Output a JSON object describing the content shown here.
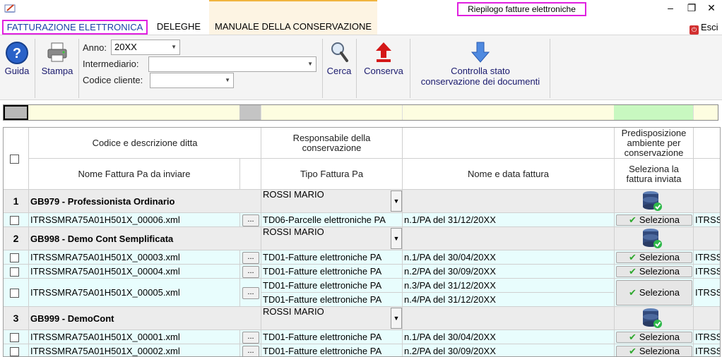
{
  "window": {
    "title": "Riepilogo fatture elettroniche",
    "minimize": "–",
    "restore": "❐",
    "close": "✕"
  },
  "tabs": [
    {
      "label": "FATTURAZIONE ELETTRONICA"
    },
    {
      "label": "DELEGHE"
    },
    {
      "label": "MANUALE DELLA CONSERVAZIONE"
    }
  ],
  "exit_label": "Esci",
  "ribbon": {
    "guida": "Guida",
    "stampa": "Stampa",
    "anno_label": "Anno:",
    "anno_value": "20XX",
    "intermediario_label": "Intermediario:",
    "intermediario_value": "",
    "codice_cliente_label": "Codice cliente:",
    "codice_cliente_value": "",
    "cerca": "Cerca",
    "conserva": "Conserva",
    "controlla_line1": "Controlla stato",
    "controlla_line2": "conservazione dei documenti"
  },
  "colors": {
    "legend_yellow": "#fdfde0",
    "legend_green": "#c8f8c0",
    "legend_gray": "#b8b8b8",
    "row_cyan": "#e8fdfd",
    "group_gray": "#ececec"
  },
  "headers": {
    "codice": "Codice e descrizione ditta",
    "responsabile": "Responsabile della conservazione",
    "predisposizione": "Predisposizione ambiente per conservazione",
    "nome_fattura": "Nome Fattura Pa da inviare",
    "tipo": "Tipo Fattura Pa",
    "nome_data": "Nome e data fattura",
    "seleziona": "Seleziona la fattura inviata"
  },
  "select_label": "Seleziona",
  "dots_label": "...",
  "groups": [
    {
      "num": "1",
      "name": "GB979 - Professionista Ordinario",
      "responsabile": "ROSSI MARIO",
      "rows": [
        {
          "file": "ITRSSMRA75A01H501X_00006.xml",
          "tipi": [
            "TD06-Parcelle elettroniche PA"
          ],
          "fatture": [
            "n.1/PA del 31/12/20XX"
          ],
          "extra": "ITRSS"
        }
      ]
    },
    {
      "num": "2",
      "name": "GB998 - Demo Cont Semplificata",
      "responsabile": "ROSSI MARIO",
      "rows": [
        {
          "file": "ITRSSMRA75A01H501X_00003.xml",
          "tipi": [
            "TD01-Fatture elettroniche PA"
          ],
          "fatture": [
            "n.1/PA del 30/04/20XX"
          ],
          "extra": "ITRSS"
        },
        {
          "file": "ITRSSMRA75A01H501X_00004.xml",
          "tipi": [
            "TD01-Fatture elettroniche PA"
          ],
          "fatture": [
            "n.2/PA del 30/09/20XX"
          ],
          "extra": "ITRSS"
        },
        {
          "file": "ITRSSMRA75A01H501X_00005.xml",
          "tipi": [
            "TD01-Fatture elettroniche PA",
            "TD01-Fatture elettroniche PA"
          ],
          "fatture": [
            "n.3/PA del 31/12/20XX",
            "n.4/PA del 31/12/20XX"
          ],
          "extra": "ITRSS"
        }
      ]
    },
    {
      "num": "3",
      "name": "GB999 - DemoCont",
      "responsabile": "ROSSI MARIO",
      "rows": [
        {
          "file": "ITRSSMRA75A01H501X_00001.xml",
          "tipi": [
            "TD01-Fatture elettroniche PA"
          ],
          "fatture": [
            "n.1/PA del 30/04/20XX"
          ],
          "extra": "ITRSS"
        },
        {
          "file": "ITRSSMRA75A01H501X_00002.xml",
          "tipi": [
            "TD01-Fatture elettroniche PA"
          ],
          "fatture": [
            "n.2/PA del 30/09/20XX"
          ],
          "extra": "ITRSS"
        }
      ]
    }
  ]
}
